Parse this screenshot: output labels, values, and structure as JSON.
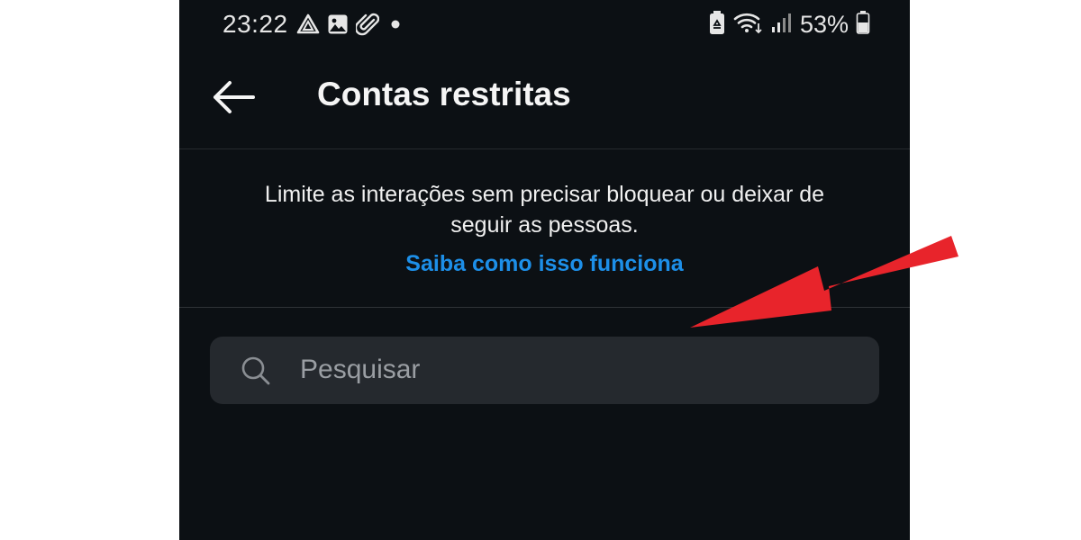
{
  "status_bar": {
    "time": "23:22",
    "battery_percent": "53%",
    "left_icons": [
      "drive-icon",
      "image-icon",
      "paperclip-icon",
      "dot-icon"
    ],
    "right_icons": [
      "battery-saver-icon",
      "wifi-icon",
      "signal-icon",
      "battery-icon"
    ]
  },
  "header": {
    "title": "Contas restritas",
    "back_icon": "arrow-left-icon"
  },
  "info": {
    "description": "Limite as interações sem precisar bloquear ou deixar de seguir as pessoas.",
    "link_label": "Saiba como isso funciona"
  },
  "search": {
    "placeholder": "Pesquisar",
    "value": "",
    "icon": "search-icon"
  },
  "colors": {
    "background": "#0c1014",
    "search_background": "#25292e",
    "link": "#1d8fe8",
    "annotation_arrow": "#e8242b"
  }
}
